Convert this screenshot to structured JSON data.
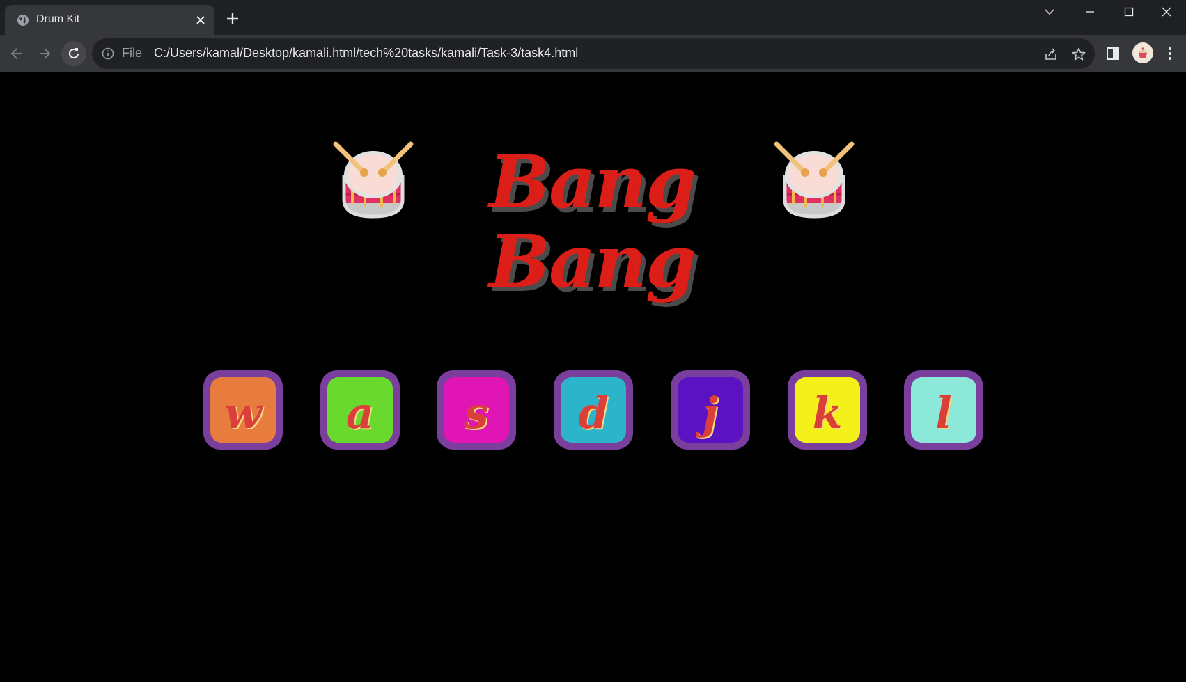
{
  "browser": {
    "tab": {
      "title": "Drum Kit",
      "favicon": "globe-icon"
    },
    "omnibox": {
      "scheme_label": "File",
      "url": "C:/Users/kamal/Desktop/kamali.html/tech%20tasks/kamali/Task-3/task4.html"
    }
  },
  "page": {
    "title": "Bang Bang",
    "title_color": "#db1f18",
    "drum_icon": "drum-with-drumsticks-icon",
    "pads": [
      {
        "key": "w",
        "color": "#e87c3e"
      },
      {
        "key": "a",
        "color": "#69d92e"
      },
      {
        "key": "s",
        "color": "#e114b4"
      },
      {
        "key": "d",
        "color": "#2cb4cb"
      },
      {
        "key": "j",
        "color": "#5a12c2"
      },
      {
        "key": "k",
        "color": "#f4f01a"
      },
      {
        "key": "l",
        "color": "#8ce8d9"
      }
    ],
    "pad_border_color": "#7a3f9d",
    "letter_color": "#da3f3a"
  }
}
